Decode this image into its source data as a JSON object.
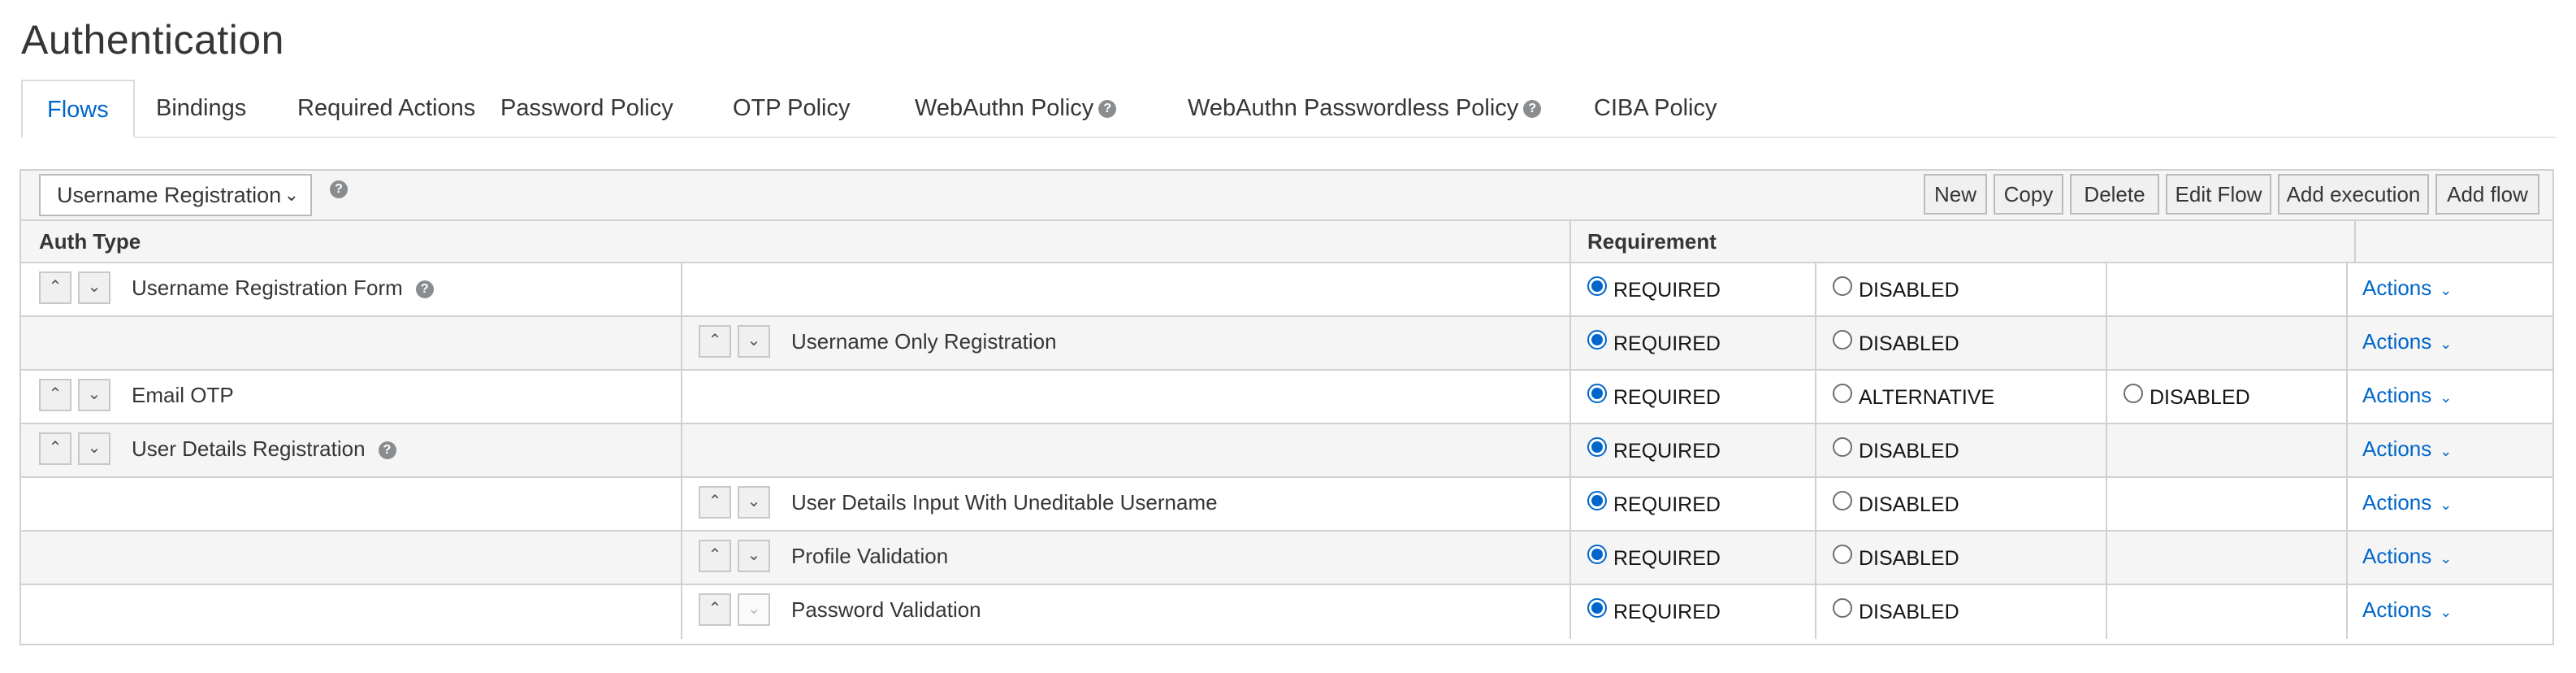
{
  "page": {
    "title": "Authentication"
  },
  "tabs": [
    {
      "label": "Flows",
      "active": true
    },
    {
      "label": "Bindings"
    },
    {
      "label": "Required Actions"
    },
    {
      "label": "Password Policy"
    },
    {
      "label": "OTP Policy"
    },
    {
      "label": "WebAuthn Policy",
      "help": true
    },
    {
      "label": "WebAuthn Passwordless Policy",
      "help": true
    },
    {
      "label": "CIBA Policy"
    }
  ],
  "toolbar": {
    "flow_select_value": "Username Registration",
    "buttons": {
      "new": "New",
      "copy": "Copy",
      "delete": "Delete",
      "edit_flow": "Edit Flow",
      "add_execution": "Add execution",
      "add_flow": "Add flow"
    }
  },
  "table": {
    "headers": {
      "auth_type": "Auth Type",
      "requirement": "Requirement"
    },
    "rows": [
      {
        "name": "Username Registration Form",
        "help": true,
        "col1": "REQUIRED",
        "col2": "DISABLED",
        "col3": "",
        "actions": "Actions"
      },
      {
        "name": "Username Only Registration",
        "col1": "REQUIRED",
        "col2": "DISABLED",
        "col3": "",
        "actions": "Actions"
      },
      {
        "name": "Email OTP",
        "col1": "REQUIRED",
        "col2": "ALTERNATIVE",
        "col3": "DISABLED",
        "actions": "Actions"
      },
      {
        "name": "User Details Registration",
        "help": true,
        "col1": "REQUIRED",
        "col2": "DISABLED",
        "col3": "",
        "actions": "Actions"
      },
      {
        "name": "User Details Input With Uneditable Username",
        "col1": "REQUIRED",
        "col2": "DISABLED",
        "col3": "",
        "actions": "Actions"
      },
      {
        "name": "Profile Validation",
        "col1": "REQUIRED",
        "col2": "DISABLED",
        "col3": "",
        "actions": "Actions"
      },
      {
        "name": "Password Validation",
        "col1": "REQUIRED",
        "col2": "DISABLED",
        "col3": "",
        "actions": "Actions"
      }
    ]
  },
  "colors": {
    "accent": "#0066cc",
    "border": "#d1d1d1",
    "stripe": "#f5f5f5"
  },
  "icons": {
    "help": "question-circle-icon",
    "up": "chevron-up-icon",
    "down": "chevron-down-icon",
    "select": "caret-down-icon"
  }
}
